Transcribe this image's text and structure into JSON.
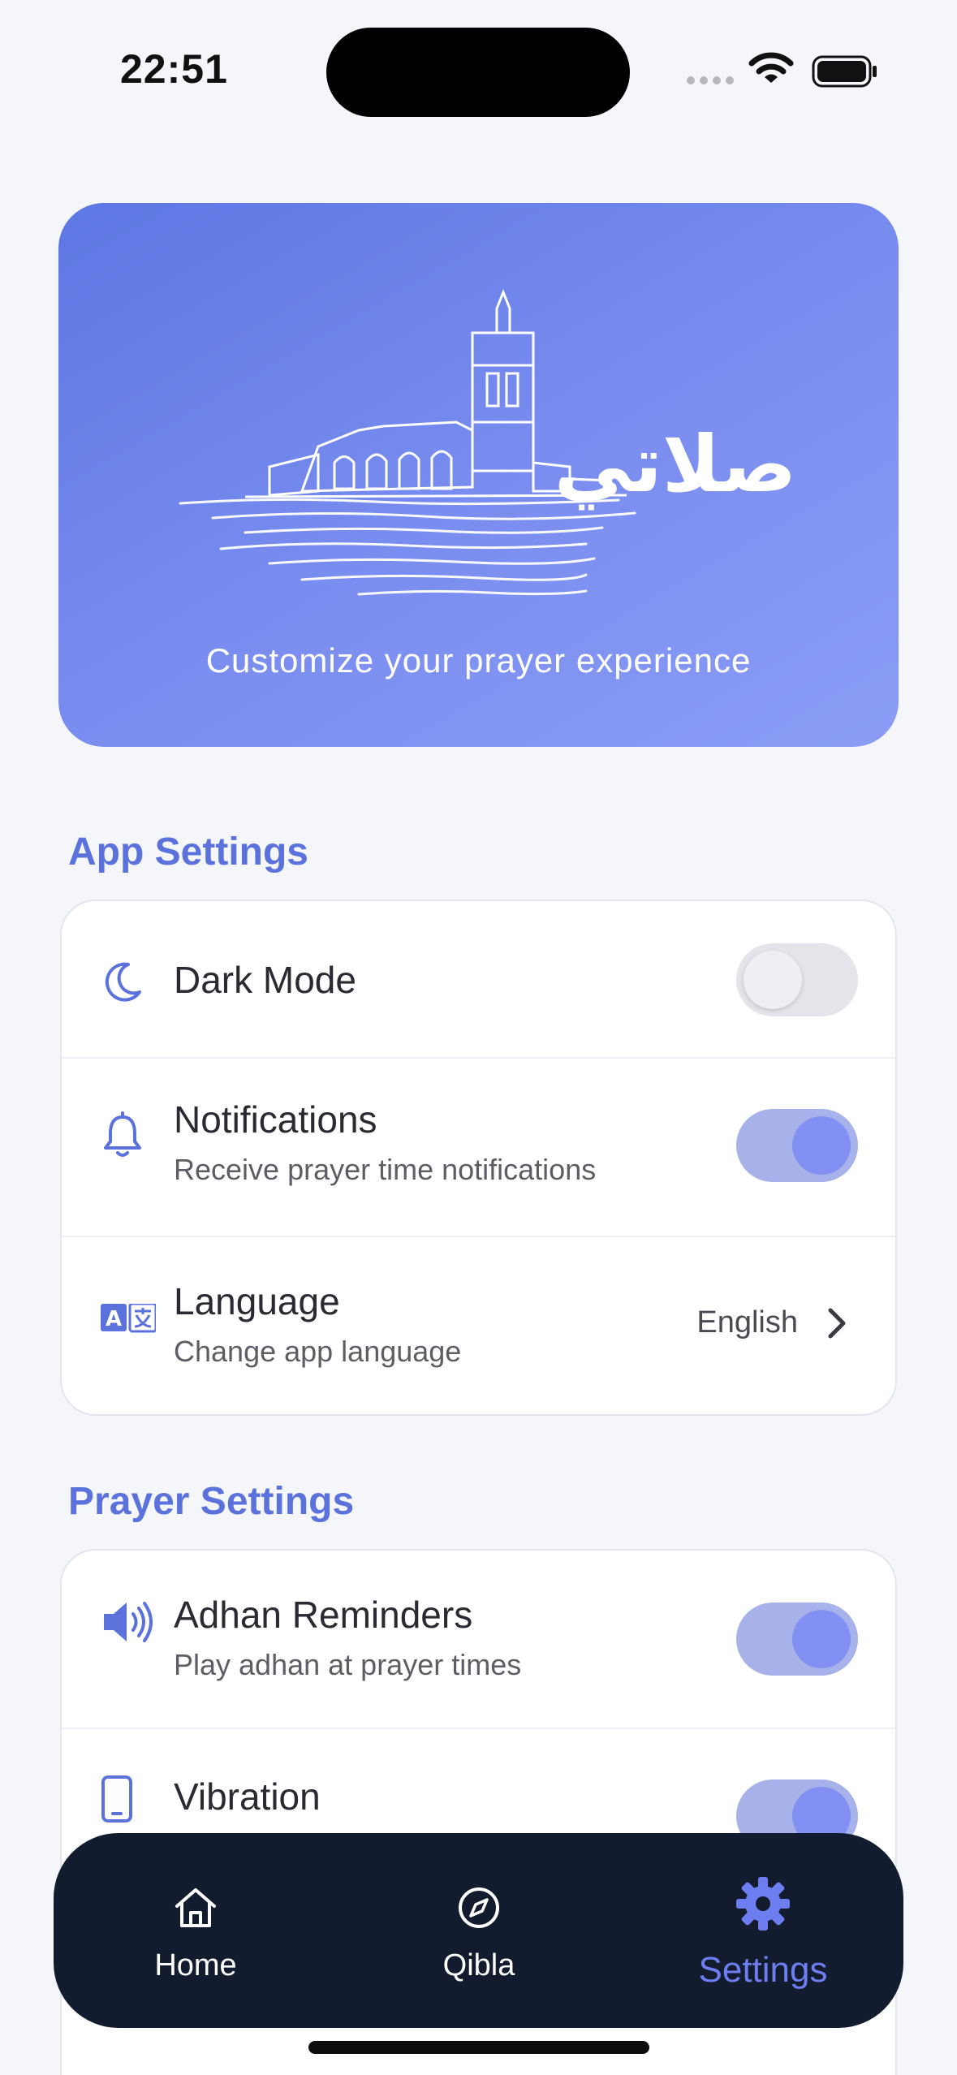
{
  "status_bar": {
    "time": "22:51"
  },
  "hero": {
    "logo_text": "صلاتي",
    "subtitle": "Customize your prayer experience"
  },
  "app_settings": {
    "title": "App Settings",
    "dark_mode": {
      "label": "Dark Mode",
      "enabled": false,
      "icon": "moon-icon"
    },
    "notifications": {
      "label": "Notifications",
      "sublabel": "Receive prayer time notifications",
      "enabled": true,
      "icon": "bell-icon"
    },
    "language": {
      "label": "Language",
      "sublabel": "Change app language",
      "value": "English",
      "icon": "translate-icon"
    }
  },
  "prayer_settings": {
    "title": "Prayer Settings",
    "adhan_reminders": {
      "label": "Adhan Reminders",
      "sublabel": "Play adhan at prayer times",
      "enabled": true,
      "icon": "speaker-icon"
    },
    "vibration": {
      "label": "Vibration",
      "enabled": true,
      "icon": "phone-icon"
    }
  },
  "bottom_nav": {
    "items": [
      {
        "label": "Home",
        "icon": "home-icon",
        "active": false
      },
      {
        "label": "Qibla",
        "icon": "compass-icon",
        "active": false
      },
      {
        "label": "Settings",
        "icon": "gear-icon",
        "active": true
      }
    ]
  },
  "colors": {
    "accent": "#5b72dc",
    "toggle_on_track": "#a7b1ea",
    "toggle_on_knob": "#8190f2",
    "nav_background": "#131b2e",
    "hero_gradient_start": "#5d77e3",
    "hero_gradient_end": "#8a9cf5"
  }
}
